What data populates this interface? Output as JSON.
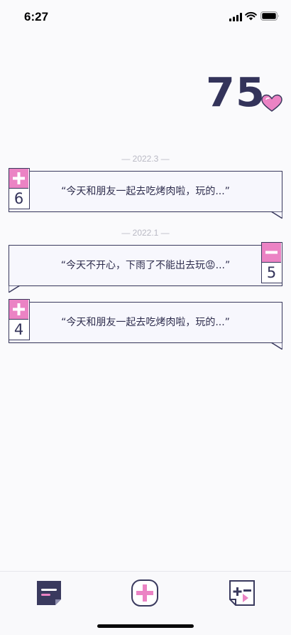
{
  "status_bar": {
    "time": "6:27"
  },
  "score": {
    "value": "75",
    "icon": "heart-icon",
    "icon_color": "#eb83c4"
  },
  "colors": {
    "accent": "#eb83c4",
    "ink": "#33335a",
    "card_bg": "#f7f7fd"
  },
  "records": [
    {
      "date_label": "— 2022.3 —",
      "sign": "plus",
      "points": "6",
      "text": "“今天和朋友一起去吃烤肉啦，玩的...”"
    },
    {
      "date_label": "— 2022.1 —",
      "sign": "minus",
      "points": "5",
      "text": "“今天不开心，下雨了不能出去玩😡...”"
    },
    {
      "date_label": "",
      "sign": "plus",
      "points": "4",
      "text": "“今天和朋友一起去吃烤肉啦，玩的...”"
    }
  ],
  "tab_bar": {
    "tabs": [
      {
        "icon": "notes-list-icon",
        "active": true
      },
      {
        "icon": "add-record-icon",
        "active": false
      },
      {
        "icon": "plus-minus-icon",
        "active": false
      }
    ]
  }
}
